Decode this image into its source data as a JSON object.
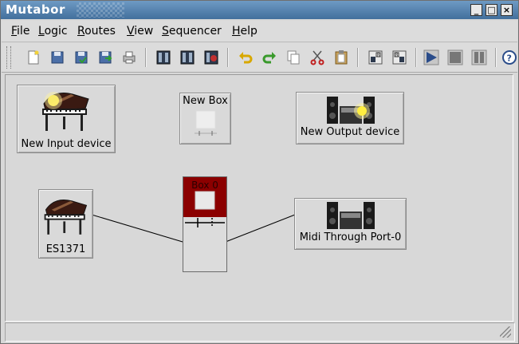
{
  "window": {
    "title": "Mutabor",
    "controls": [
      "minimize",
      "maximize",
      "close"
    ]
  },
  "menubar": [
    {
      "underline": "F",
      "rest": "ile"
    },
    {
      "underline": "L",
      "rest": "ogic"
    },
    {
      "underline": "R",
      "rest": "outes"
    },
    {
      "underline": "V",
      "rest": "iew"
    },
    {
      "underline": "S",
      "rest": "equencer"
    },
    {
      "underline": "H",
      "rest": "elp"
    }
  ],
  "toolbar": {
    "icons": [
      "new-file-icon",
      "open-icon",
      "save-icon",
      "save-as-icon",
      "print-icon",
      "logic-new-icon",
      "logic-open-icon",
      "logic-save-icon",
      "undo-icon",
      "redo-icon",
      "copy-icon",
      "cut-icon",
      "paste-icon",
      "route-load-icon",
      "route-save-icon",
      "play-icon",
      "stop-icon",
      "pause-icon",
      "help-icon"
    ]
  },
  "canvas": {
    "devices": {
      "new_input": "New Input device",
      "new_box": "New Box",
      "new_output": "New Output device",
      "es1371": "ES1371",
      "box0": "Box 0",
      "midi_through": "Midi Through Port-0"
    }
  },
  "colors": {
    "titlebar": "#4f7eab",
    "box_header": "#8b0000",
    "accent_blue": "#2a4c8a"
  }
}
